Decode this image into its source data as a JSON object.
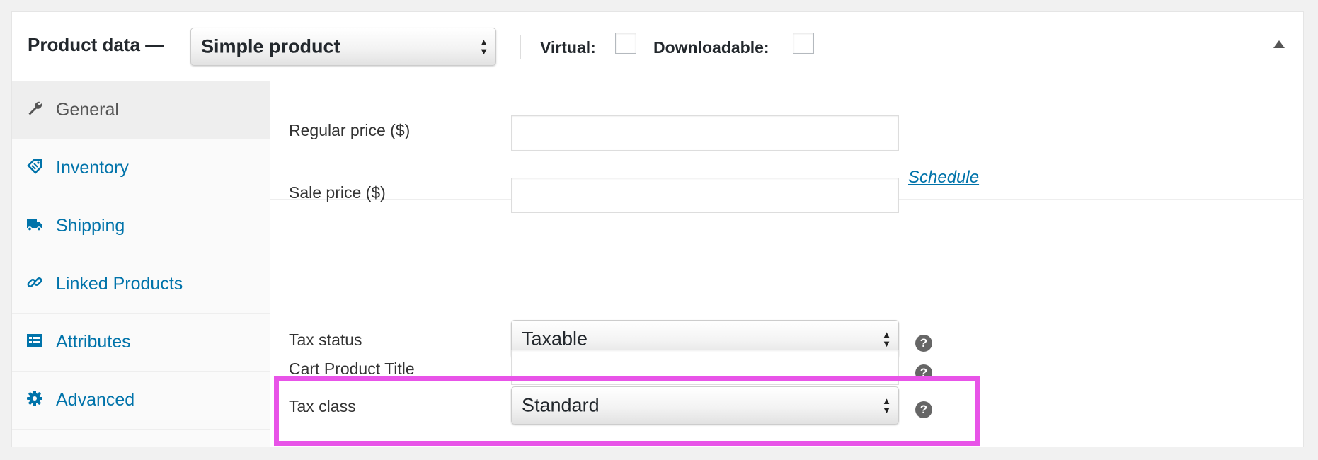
{
  "header": {
    "title": "Product data —",
    "product_type": "Simple product",
    "virtual_label": "Virtual:",
    "downloadable_label": "Downloadable:"
  },
  "tabs": [
    {
      "label": "General",
      "icon": "wrench-icon",
      "active": true
    },
    {
      "label": "Inventory",
      "icon": "tag-icon"
    },
    {
      "label": "Shipping",
      "icon": "truck-icon"
    },
    {
      "label": "Linked Products",
      "icon": "link-icon"
    },
    {
      "label": "Attributes",
      "icon": "list-view-icon"
    },
    {
      "label": "Advanced",
      "icon": "gear-icon"
    }
  ],
  "fields": {
    "regular_price_label": "Regular price ($)",
    "sale_price_label": "Sale price ($)",
    "schedule_link": "Schedule",
    "tax_status_label": "Tax status",
    "tax_status_value": "Taxable",
    "tax_class_label": "Tax class",
    "tax_class_value": "Standard",
    "cart_product_title_label": "Cart Product Title"
  },
  "help_icon_glyph": "?",
  "colors": {
    "link": "#0073aa",
    "highlight": "#e854e8",
    "active_tab_bg": "#eeeeee"
  }
}
